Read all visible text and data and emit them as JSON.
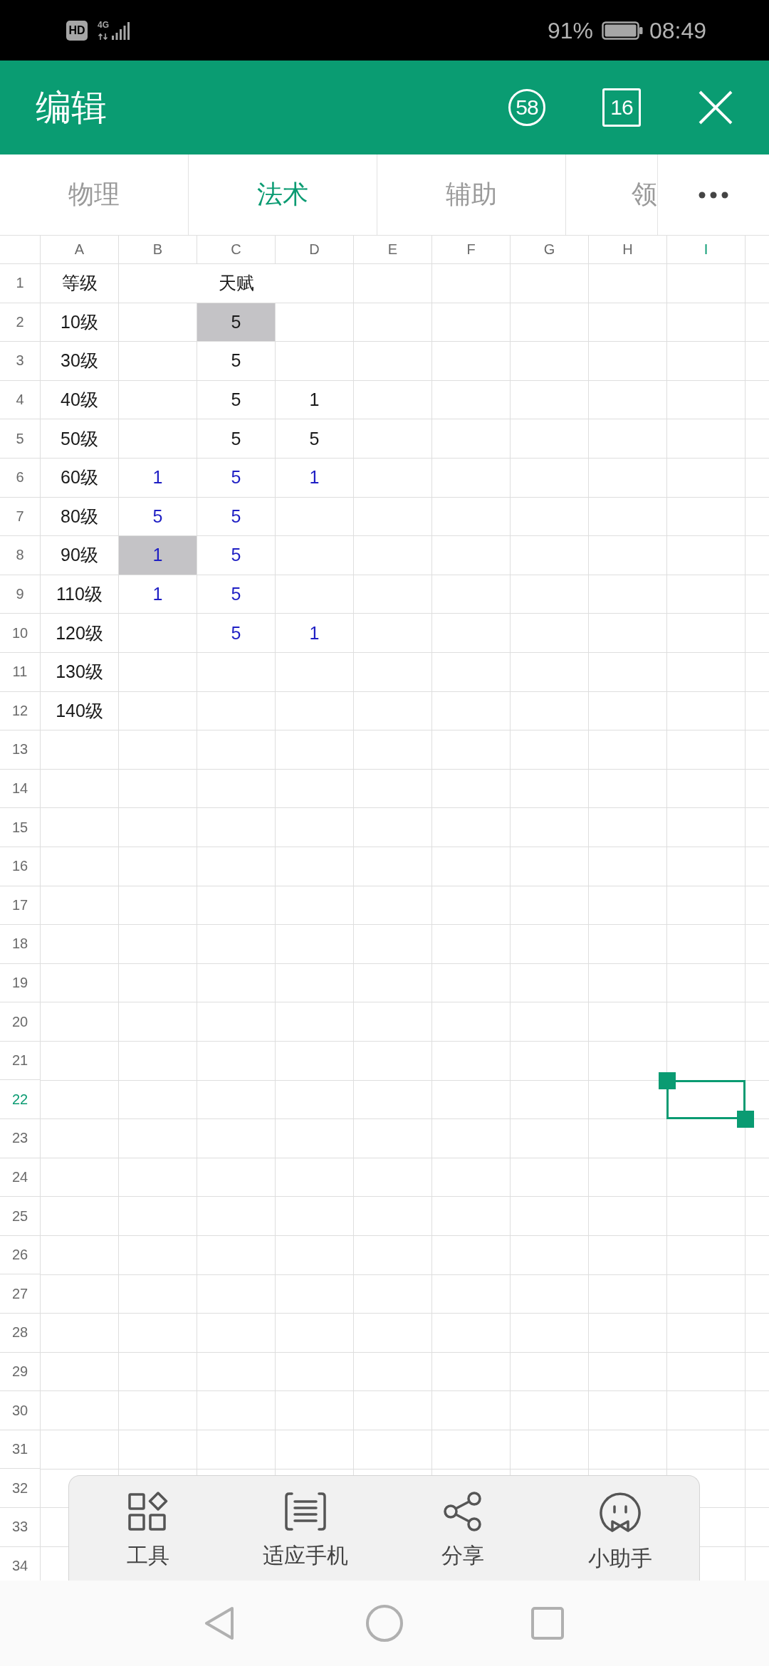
{
  "status_bar": {
    "hd_badge": "HD",
    "network": "4G",
    "battery": "91%",
    "time": "08:49"
  },
  "header": {
    "title": "编辑",
    "circle_badge": "58",
    "square_badge": "16"
  },
  "tabs": [
    {
      "label": "物理",
      "selected": false
    },
    {
      "label": "法术",
      "selected": true
    },
    {
      "label": "辅助",
      "selected": false
    },
    {
      "label": "领",
      "selected": false
    }
  ],
  "sheet": {
    "columns": [
      {
        "label": "A",
        "selected": false
      },
      {
        "label": "B",
        "selected": false
      },
      {
        "label": "C",
        "selected": false
      },
      {
        "label": "D",
        "selected": false
      },
      {
        "label": "E",
        "selected": false
      },
      {
        "label": "F",
        "selected": false
      },
      {
        "label": "G",
        "selected": false
      },
      {
        "label": "H",
        "selected": false
      },
      {
        "label": "I",
        "selected": true
      }
    ],
    "rows": [
      {
        "number": "1",
        "selected": false,
        "cells": [
          {
            "kind": "value",
            "text": "等级",
            "color": "#1a1a1a",
            "highlighted": false
          },
          {
            "kind": "merged",
            "text": "天赋",
            "color": "#1a1a1a",
            "highlighted": false
          },
          {
            "kind": "covered"
          },
          {
            "kind": "covered"
          }
        ]
      },
      {
        "number": "2",
        "selected": false,
        "cells": [
          {
            "kind": "value",
            "text": "10级",
            "color": "#1a1a1a",
            "highlighted": false
          },
          {
            "kind": "blank"
          },
          {
            "kind": "value",
            "text": "5",
            "color": "#1a1a1a",
            "highlighted": true
          }
        ]
      },
      {
        "number": "3",
        "selected": false,
        "cells": [
          {
            "kind": "value",
            "text": "30级",
            "color": "#1a1a1a",
            "highlighted": false
          },
          {
            "kind": "blank"
          },
          {
            "kind": "value",
            "text": "5",
            "color": "#1a1a1a",
            "highlighted": false
          }
        ]
      },
      {
        "number": "4",
        "selected": false,
        "cells": [
          {
            "kind": "value",
            "text": "40级",
            "color": "#1a1a1a",
            "highlighted": false
          },
          {
            "kind": "blank"
          },
          {
            "kind": "value",
            "text": "5",
            "color": "#1a1a1a",
            "highlighted": false
          },
          {
            "kind": "value",
            "text": "1",
            "color": "#1a1a1a",
            "highlighted": false
          }
        ]
      },
      {
        "number": "5",
        "selected": false,
        "cells": [
          {
            "kind": "value",
            "text": "50级",
            "color": "#1a1a1a",
            "highlighted": false
          },
          {
            "kind": "blank"
          },
          {
            "kind": "value",
            "text": "5",
            "color": "#1a1a1a",
            "highlighted": false
          },
          {
            "kind": "value",
            "text": "5",
            "color": "#1a1a1a",
            "highlighted": false
          }
        ]
      },
      {
        "number": "6",
        "selected": false,
        "cells": [
          {
            "kind": "value",
            "text": "60级",
            "color": "#1a1a1a",
            "highlighted": false
          },
          {
            "kind": "value",
            "text": "1",
            "color": "#1f1fc4",
            "highlighted": false
          },
          {
            "kind": "value",
            "text": "5",
            "color": "#1f1fc4",
            "highlighted": false
          },
          {
            "kind": "value",
            "text": "1",
            "color": "#1f1fc4",
            "highlighted": false
          }
        ]
      },
      {
        "number": "7",
        "selected": false,
        "cells": [
          {
            "kind": "value",
            "text": "80级",
            "color": "#1a1a1a",
            "highlighted": false
          },
          {
            "kind": "value",
            "text": "5",
            "color": "#1f1fc4",
            "highlighted": false
          },
          {
            "kind": "value",
            "text": "5",
            "color": "#1f1fc4",
            "highlighted": false
          }
        ]
      },
      {
        "number": "8",
        "selected": false,
        "cells": [
          {
            "kind": "value",
            "text": "90级",
            "color": "#1a1a1a",
            "highlighted": false
          },
          {
            "kind": "value",
            "text": "1",
            "color": "#1f1fc4",
            "highlighted": true
          },
          {
            "kind": "value",
            "text": "5",
            "color": "#1f1fc4",
            "highlighted": false
          }
        ]
      },
      {
        "number": "9",
        "selected": false,
        "cells": [
          {
            "kind": "value",
            "text": "110级",
            "color": "#1a1a1a",
            "highlighted": false
          },
          {
            "kind": "value",
            "text": "1",
            "color": "#1f1fc4",
            "highlighted": false
          },
          {
            "kind": "value",
            "text": "5",
            "color": "#1f1fc4",
            "highlighted": false
          }
        ]
      },
      {
        "number": "10",
        "selected": false,
        "cells": [
          {
            "kind": "value",
            "text": "120级",
            "color": "#1a1a1a",
            "highlighted": false
          },
          {
            "kind": "blank"
          },
          {
            "kind": "value",
            "text": "5",
            "color": "#1f1fc4",
            "highlighted": false
          },
          {
            "kind": "value",
            "text": "1",
            "color": "#1f1fc4",
            "highlighted": false
          }
        ]
      },
      {
        "number": "11",
        "selected": false,
        "cells": [
          {
            "kind": "value",
            "text": "130级",
            "color": "#1a1a1a",
            "highlighted": false
          }
        ]
      },
      {
        "number": "12",
        "selected": false,
        "cells": [
          {
            "kind": "value",
            "text": "140级",
            "color": "#1a1a1a",
            "highlighted": false
          }
        ]
      },
      {
        "number": "13",
        "selected": false
      },
      {
        "number": "14",
        "selected": false
      },
      {
        "number": "15",
        "selected": false
      },
      {
        "number": "16",
        "selected": false
      },
      {
        "number": "17",
        "selected": false
      },
      {
        "number": "18",
        "selected": false
      },
      {
        "number": "19",
        "selected": false
      },
      {
        "number": "20",
        "selected": false
      },
      {
        "number": "21",
        "selected": false
      },
      {
        "number": "22",
        "selected": true
      },
      {
        "number": "23",
        "selected": false
      },
      {
        "number": "24",
        "selected": false
      },
      {
        "number": "25",
        "selected": false
      },
      {
        "number": "26",
        "selected": false
      },
      {
        "number": "27",
        "selected": false
      },
      {
        "number": "28",
        "selected": false
      },
      {
        "number": "29",
        "selected": false
      },
      {
        "number": "30",
        "selected": false
      },
      {
        "number": "31",
        "selected": false
      },
      {
        "number": "32",
        "selected": false
      },
      {
        "number": "33",
        "selected": false
      },
      {
        "number": "34",
        "selected": false
      }
    ]
  },
  "toolbar": [
    {
      "kind": "tools",
      "label": "工具"
    },
    {
      "kind": "fit",
      "label": "适应手机"
    },
    {
      "kind": "share",
      "label": "分享"
    },
    {
      "kind": "assistant",
      "label": "小助手"
    }
  ]
}
